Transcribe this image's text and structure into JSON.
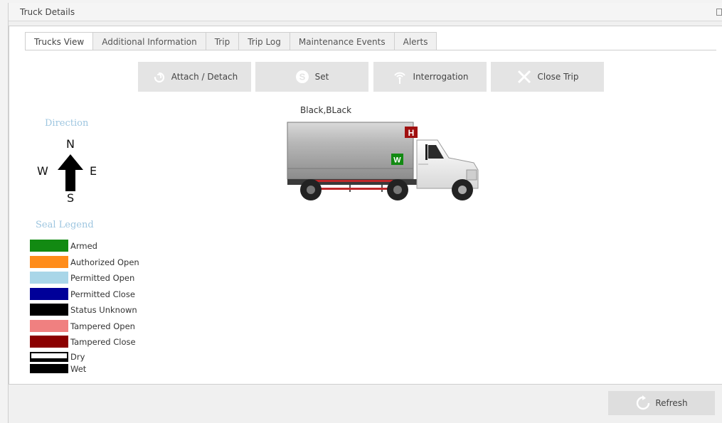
{
  "window": {
    "title": "Truck Details"
  },
  "tabs": [
    {
      "label": "Trucks View",
      "active": true
    },
    {
      "label": "Additional Information"
    },
    {
      "label": "Trip"
    },
    {
      "label": "Trip Log"
    },
    {
      "label": "Maintenance Events"
    },
    {
      "label": "Alerts"
    }
  ],
  "toolbar": {
    "attach_detach": {
      "label": "Attach / Detach",
      "icon": "link-icon"
    },
    "set": {
      "label": "Set",
      "icon": "set-s-icon"
    },
    "interrogation": {
      "label": "Interrogation",
      "icon": "signal-icon"
    },
    "close_trip": {
      "label": "Close Trip",
      "icon": "close-x-icon"
    }
  },
  "direction": {
    "label": "Direction",
    "n": "N",
    "s": "S",
    "e": "E",
    "w": "W",
    "heading": "north"
  },
  "seal_legend": {
    "label": "Seal Legend",
    "items": [
      {
        "label": "Armed",
        "color": "#128a12"
      },
      {
        "label": "Authorized Open",
        "color": "#ff8c1a"
      },
      {
        "label": "Permitted Open",
        "color": "#a9d6e8"
      },
      {
        "label": "Permitted Close",
        "color": "#000099"
      },
      {
        "label": "Status Unknown",
        "color": "#000000"
      },
      {
        "label": "Tampered Open",
        "color": "#f08080"
      },
      {
        "label": "Tampered Close",
        "color": "#8b0000"
      },
      {
        "label": "Dry",
        "color": "#ffffff"
      },
      {
        "label": "Wet",
        "color": "#000000"
      }
    ]
  },
  "truck": {
    "label": "Black,BLack",
    "markers": [
      {
        "text": "H",
        "color": "#a01010"
      },
      {
        "text": "W",
        "color": "#128a12"
      }
    ]
  },
  "footer": {
    "refresh_label": "Refresh"
  }
}
